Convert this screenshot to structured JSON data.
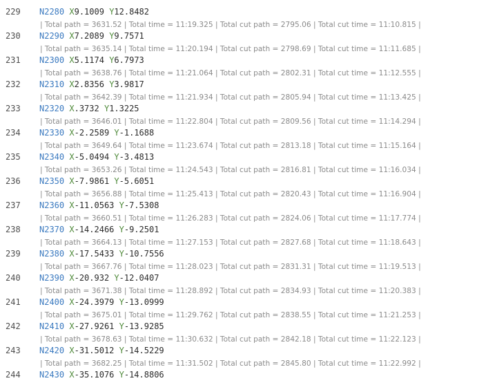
{
  "lines": [
    {
      "num": "229",
      "comment": "",
      "n": "N2280",
      "x": "9.1009",
      "y": "12.8482"
    },
    {
      "num": "230",
      "comment": "| Total path = 3631.52 | Total time = 11:19.325 | Total cut path = 2795.06 | Total cut time = 11:10.815 |",
      "n": "N2290",
      "x": "7.2089",
      "y": "9.7571"
    },
    {
      "num": "231",
      "comment": "| Total path = 3635.14 | Total time = 11:20.194 | Total cut path = 2798.69 | Total cut time = 11:11.685 |",
      "n": "N2300",
      "x": "5.1174",
      "y": "6.7973"
    },
    {
      "num": "232",
      "comment": "| Total path = 3638.76 | Total time = 11:21.064 | Total cut path = 2802.31 | Total cut time = 11:12.555 |",
      "n": "N2310",
      "x": "2.8356",
      "y": "3.9817"
    },
    {
      "num": "233",
      "comment": "| Total path = 3642.39 | Total time = 11:21.934 | Total cut path = 2805.94 | Total cut time = 11:13.425 |",
      "n": "N2320",
      "x": ".3732",
      "y": "1.3225"
    },
    {
      "num": "234",
      "comment": "| Total path = 3646.01 | Total time = 11:22.804 | Total cut path = 2809.56 | Total cut time = 11:14.294 |",
      "n": "N2330",
      "x": "-2.2589",
      "y": "-1.1688"
    },
    {
      "num": "235",
      "comment": "| Total path = 3649.64 | Total time = 11:23.674 | Total cut path = 2813.18 | Total cut time = 11:15.164 |",
      "n": "N2340",
      "x": "-5.0494",
      "y": "-3.4813"
    },
    {
      "num": "236",
      "comment": "| Total path = 3653.26 | Total time = 11:24.543 | Total cut path = 2816.81 | Total cut time = 11:16.034 |",
      "n": "N2350",
      "x": "-7.9861",
      "y": "-5.6051"
    },
    {
      "num": "237",
      "comment": "| Total path = 3656.88 | Total time = 11:25.413 | Total cut path = 2820.43 | Total cut time = 11:16.904 |",
      "n": "N2360",
      "x": "-11.0563",
      "y": "-7.5308"
    },
    {
      "num": "238",
      "comment": "| Total path = 3660.51 | Total time = 11:26.283 | Total cut path = 2824.06 | Total cut time = 11:17.774 |",
      "n": "N2370",
      "x": "-14.2466",
      "y": "-9.2501"
    },
    {
      "num": "239",
      "comment": "| Total path = 3664.13 | Total time = 11:27.153 | Total cut path = 2827.68 | Total cut time = 11:18.643 |",
      "n": "N2380",
      "x": "-17.5433",
      "y": "-10.7556"
    },
    {
      "num": "240",
      "comment": "| Total path = 3667.76 | Total time = 11:28.023 | Total cut path = 2831.31 | Total cut time = 11:19.513 |",
      "n": "N2390",
      "x": "-20.932",
      "y": "-12.0407"
    },
    {
      "num": "241",
      "comment": "| Total path = 3671.38 | Total time = 11:28.892 | Total cut path = 2834.93 | Total cut time = 11:20.383 |",
      "n": "N2400",
      "x": "-24.3979",
      "y": "-13.0999"
    },
    {
      "num": "242",
      "comment": "| Total path = 3675.01 | Total time = 11:29.762 | Total cut path = 2838.55 | Total cut time = 11:21.253 |",
      "n": "N2410",
      "x": "-27.9261",
      "y": "-13.9285"
    },
    {
      "num": "243",
      "comment": "| Total path = 3678.63 | Total time = 11:30.632 | Total cut path = 2842.18 | Total cut time = 11:22.123 |",
      "n": "N2420",
      "x": "-31.5012",
      "y": "-14.5229"
    },
    {
      "num": "244",
      "comment": "| Total path = 3682.25 | Total time = 11:31.502 | Total cut path = 2845.80 | Total cut time = 11:22.992 |",
      "n": "N2430",
      "x": "-35.1076",
      "y": "-14.8806"
    }
  ],
  "letters": {
    "x": "X",
    "y": "Y"
  }
}
